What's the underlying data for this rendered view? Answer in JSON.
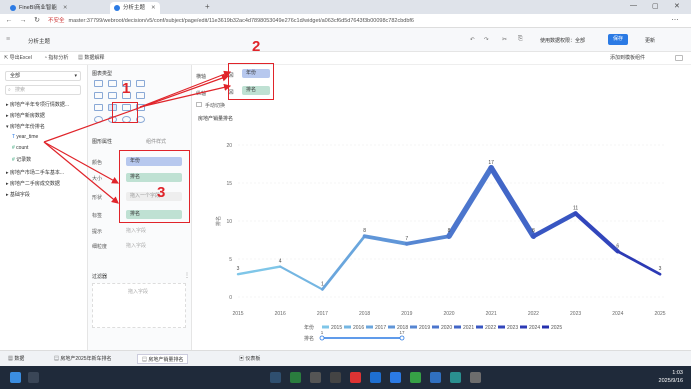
{
  "browser": {
    "tabs": [
      {
        "label": "FineBI商业智能",
        "active": false
      },
      {
        "label": "分析主题",
        "active": true
      }
    ],
    "insecure_label": "不安全",
    "url": "master:37799/webroot/decision/v5/conf/subject/page/edit/11e3619b32ac4d7898053049e276c1d/widget/a063cf6d5d7643f3b00098c782cbdbf6"
  },
  "app_header": {
    "title": "分析主题",
    "right_control": "使用数据权限：全部",
    "save_label": "保存",
    "update_label": "更新"
  },
  "toolbar2": {
    "items": [
      "导出Excel",
      "指标分析",
      "数据解释"
    ],
    "right_label": "添加到模板组件"
  },
  "left_panel": {
    "dataset_select": "全部",
    "search_placeholder": "搜索",
    "tree": [
      "房地产半年专项行情数据...",
      "房地产新房数据",
      "房地产年份排名",
      "year_time",
      "count",
      "记录数",
      "房地产市场二手车基本...",
      "房地产二手房成交数据",
      "基础字段"
    ]
  },
  "cfg_panel": {
    "chart_type_label": "图表类型",
    "graphic_attr_label": "图形属性",
    "style_label": "组件样式",
    "props": {
      "color": "颜色",
      "size": "大小",
      "shape": "形状",
      "label": "标签",
      "tooltip": "提示",
      "detail": "细粒度"
    },
    "color_field": "年份",
    "size_field": "排名",
    "shape_placeholder": "拖入一个字段",
    "label_field": "排名",
    "tooltip_placeholder": "拖入字段",
    "detail_placeholder": "拖入字段",
    "filter_label": "过滤器",
    "filter_placeholder": "拖入字段"
  },
  "chart_area": {
    "x_axis_label": "横轴",
    "y_axis_label": "纵轴",
    "x_field": "年份",
    "y_field": "排名",
    "manual_toggle": "手动切换",
    "chart_title": "房地产销量排名"
  },
  "annotations": {
    "num1": "1",
    "num2": "2",
    "num3": "3"
  },
  "chart_data": {
    "type": "line",
    "x": [
      2015,
      2016,
      2017,
      2018,
      2019,
      2020,
      2021,
      2022,
      2023,
      2024,
      2025
    ],
    "y": [
      3,
      4,
      1,
      8,
      7,
      8,
      17,
      8,
      11,
      6,
      3
    ],
    "ylim": [
      0,
      20
    ],
    "yticks": [
      0,
      5,
      10,
      15,
      20
    ],
    "ylabel": "排名",
    "legend_title": "年份",
    "legend_items": [
      "2015",
      "2016",
      "2017",
      "2018",
      "2019",
      "2020",
      "2021",
      "2022",
      "2023",
      "2024",
      "2025"
    ],
    "legend_colors": [
      "#7fc6e8",
      "#74b6e2",
      "#6aa6dd",
      "#6096d8",
      "#5686d2",
      "#4c76cd",
      "#4266c7",
      "#3856c2",
      "#3246bc",
      "#2c3ab5",
      "#2530ae"
    ],
    "size_legend_title": "排名",
    "size_range": [
      "1",
      "17"
    ]
  },
  "sheets": [
    {
      "label": "数据",
      "active": false
    },
    {
      "label": "房地产2025年新车排名",
      "active": false
    },
    {
      "label": "房地产销量排名",
      "active": true
    },
    {
      "label": "仪表板",
      "active": false
    }
  ],
  "taskbar": {
    "time": "1:03",
    "date": "2025/9/16"
  }
}
